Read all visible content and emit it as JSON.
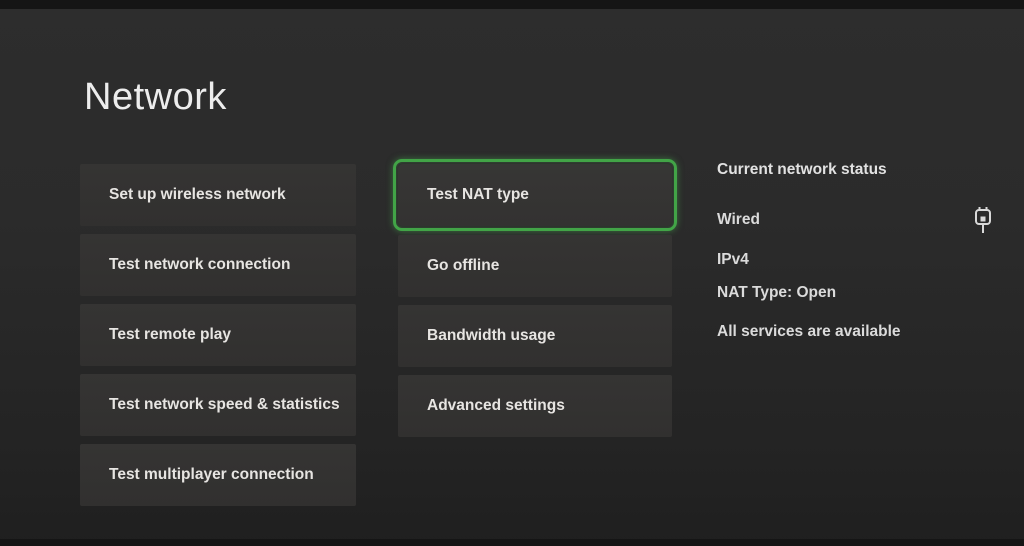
{
  "page": {
    "title": "Network"
  },
  "colors": {
    "background": "#2b2b2b",
    "tile": "#333231",
    "focus_green": "#42a447",
    "text": "#e7e5e2"
  },
  "menu": {
    "left": [
      {
        "label": "Set up wireless network"
      },
      {
        "label": "Test network connection"
      },
      {
        "label": "Test remote play"
      },
      {
        "label": "Test network speed & statistics"
      },
      {
        "label": "Test multiplayer connection"
      }
    ],
    "middle": [
      {
        "label": "Test NAT type",
        "focused": true
      },
      {
        "label": "Go offline",
        "focused": false
      },
      {
        "label": "Bandwidth usage",
        "focused": false
      },
      {
        "label": "Advanced settings",
        "focused": false
      }
    ]
  },
  "status_panel": {
    "heading": "Current network status",
    "connection_type": "Wired",
    "connection_icon": "ethernet-plug-icon",
    "ip_version": "IPv4",
    "nat_type": "NAT Type: Open",
    "services": "All services are available"
  }
}
